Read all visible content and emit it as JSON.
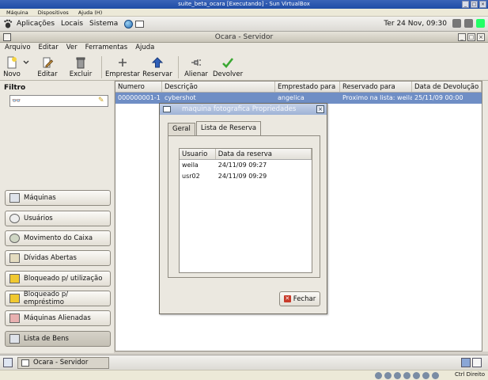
{
  "vbox": {
    "title": "suite_beta_ocara [Executando] - Sun VirtualBox",
    "menu": [
      "Máquina",
      "Dispositivos",
      "Ajuda (H)"
    ],
    "hostkey": "Ctrl Direito"
  },
  "gnome": {
    "menus": [
      "Aplicações",
      "Locais",
      "Sistema"
    ],
    "clock": "Ter 24 Nov, 09:30"
  },
  "app": {
    "title": "Ocara - Servidor",
    "menu": [
      "Arquivo",
      "Editar",
      "Ver",
      "Ferramentas",
      "Ajuda"
    ],
    "toolbar": {
      "novo": "Novo",
      "editar": "Editar",
      "excluir": "Excluir",
      "emprestar": "Emprestar",
      "reservar": "Reservar",
      "alienar": "Alienar",
      "devolver": "Devolver"
    },
    "sidebar": {
      "filter_label": "Filtro",
      "filter_value": "",
      "items": [
        "Máquinas",
        "Usuários",
        "Movimento do Caixa",
        "Dívidas Abertas",
        "Bloqueado p/ utilização",
        "Bloqueado p/ empréstimo",
        "Máquinas Alienadas",
        "Lista de Bens"
      ]
    },
    "table": {
      "columns": [
        "Numero",
        "Descrição",
        "Emprestado para",
        "Reservado para",
        "Data de Devolução"
      ],
      "rows": [
        [
          "000000001-1",
          "cybershot",
          "angelica",
          "Proximo na lista: weila",
          "25/11/09 00:00"
        ]
      ]
    }
  },
  "dialog": {
    "title": "maquina fotografica Propriedades",
    "tabs": [
      "Geral",
      "Lista de Reserva"
    ],
    "list": {
      "columns": [
        "Usuario",
        "Data da reserva"
      ],
      "rows": [
        [
          "weila",
          "24/11/09 09:27"
        ],
        [
          "usr02",
          "24/11/09 09:29"
        ]
      ]
    },
    "close_label": "Fechar"
  },
  "taskbar": {
    "window_label": "Ocara - Servidor"
  },
  "colors": {
    "selection": "#6f8ec5",
    "dialog_title": "#9fb3d6"
  }
}
